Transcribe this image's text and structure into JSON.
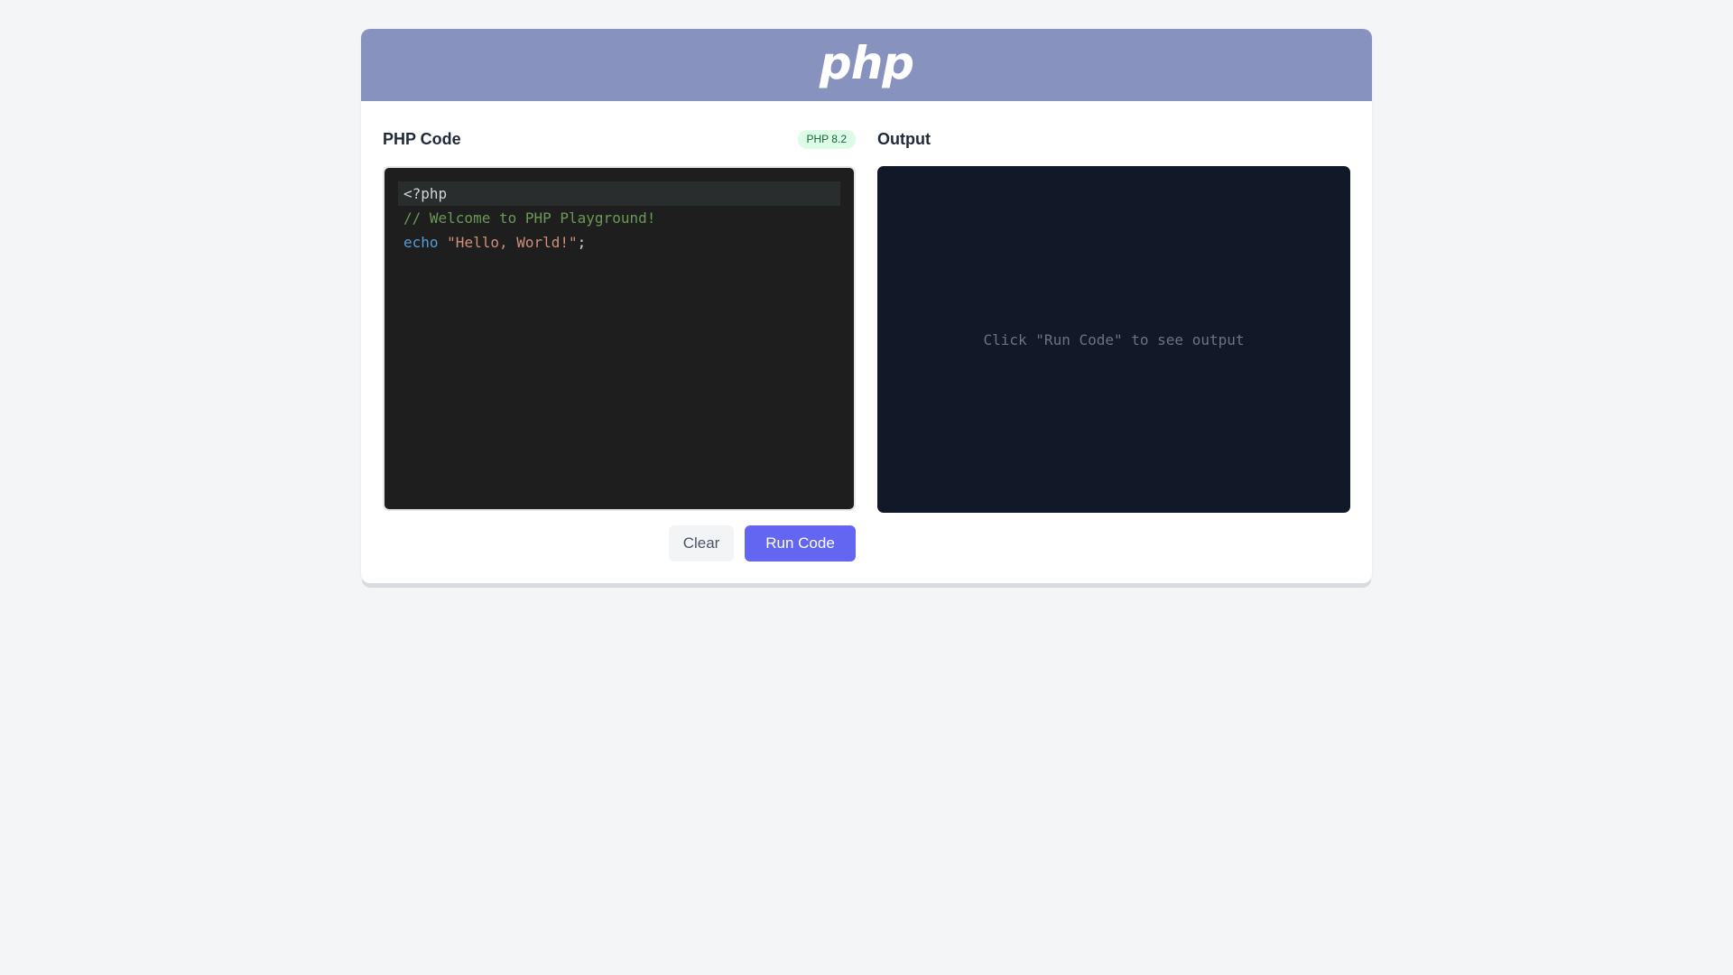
{
  "header": {
    "logo_text": "php",
    "color": "#8892bf"
  },
  "editor_panel": {
    "title": "PHP Code",
    "version_badge": "PHP 8.2",
    "code_lines": [
      [
        {
          "type": "plain",
          "text": "<?php"
        }
      ],
      [
        {
          "type": "comment",
          "text": "// Welcome to PHP Playground!"
        }
      ],
      [
        {
          "type": "keyword",
          "text": "echo"
        },
        {
          "type": "plain",
          "text": " "
        },
        {
          "type": "string",
          "text": "\"Hello, World!\""
        },
        {
          "type": "plain",
          "text": ";"
        }
      ]
    ],
    "active_line": 0
  },
  "output_panel": {
    "title": "Output",
    "placeholder": "Click \"Run Code\" to see output"
  },
  "actions": {
    "clear_label": "Clear",
    "run_label": "Run Code",
    "run_color": "#6366f1"
  }
}
